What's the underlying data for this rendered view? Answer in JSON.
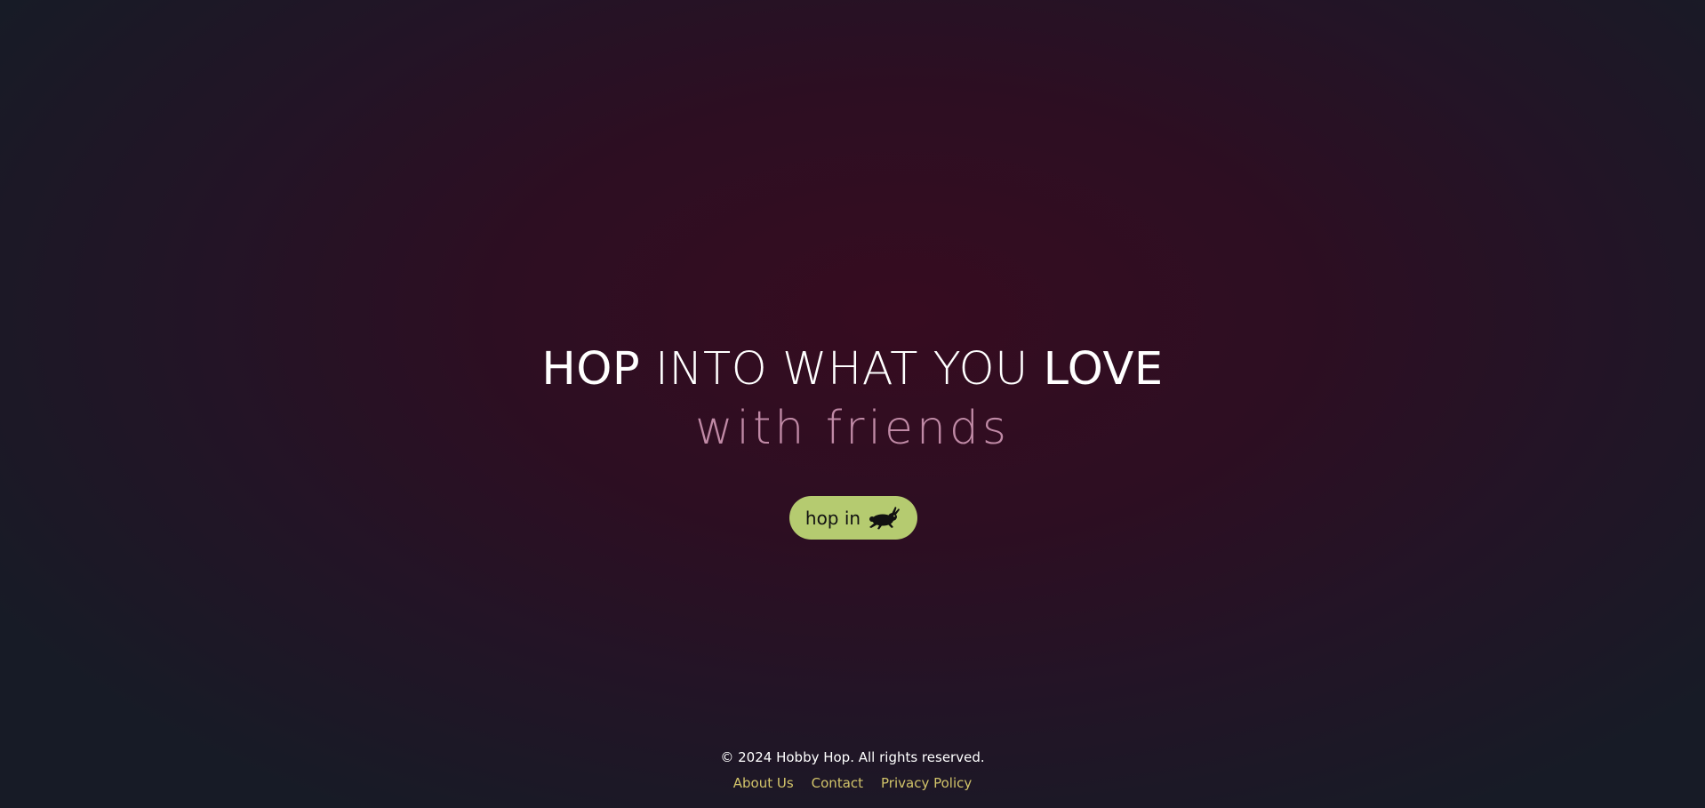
{
  "hero": {
    "headline": {
      "word_1": "HOP",
      "middle": "INTO WHAT YOU",
      "word_2": "LOVE"
    },
    "subheadline": "with friends",
    "cta_label": "hop in",
    "cta_icon": "rabbit-icon"
  },
  "footer": {
    "copyright": "© 2024 Hobby Hop. All rights reserved.",
    "links": [
      "About Us",
      "Contact",
      "Privacy Policy"
    ]
  },
  "colors": {
    "background_center": "#360c20",
    "background_edge": "#171b26",
    "accent_button": "#b5cb70",
    "subheadline": "#c08aa6",
    "footer_link": "#d2c46a"
  }
}
